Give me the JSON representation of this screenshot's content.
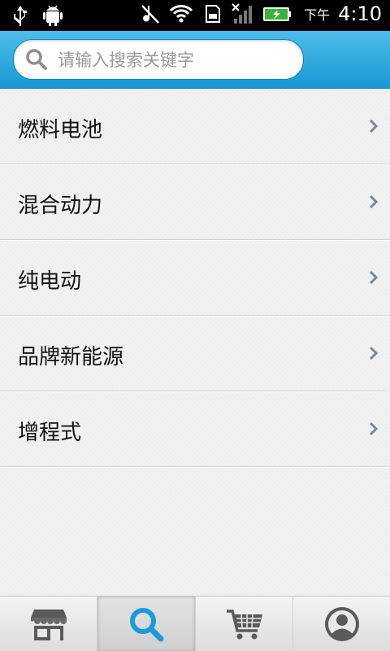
{
  "status_bar": {
    "ampm": "下午",
    "time": "4:10",
    "icons": [
      "usb-icon",
      "android-debug-icon",
      "muted-music-icon",
      "wifi-icon",
      "sd-card-icon",
      "no-signal-icon",
      "battery-charging-icon"
    ]
  },
  "search": {
    "placeholder": "请输入搜索关键字",
    "value": ""
  },
  "categories": [
    {
      "label": "燃料电池"
    },
    {
      "label": "混合动力"
    },
    {
      "label": "纯电动"
    },
    {
      "label": "品牌新能源"
    },
    {
      "label": "增程式"
    }
  ],
  "bottom_nav": [
    {
      "icon": "store-icon",
      "active": false
    },
    {
      "icon": "search-icon",
      "active": true
    },
    {
      "icon": "cart-icon",
      "active": false
    },
    {
      "icon": "account-icon",
      "active": false
    }
  ],
  "colors": {
    "header_blue": "#1898d3",
    "active_tab_icon": "#1a9ad6",
    "inactive_tab_icon": "#555555"
  }
}
